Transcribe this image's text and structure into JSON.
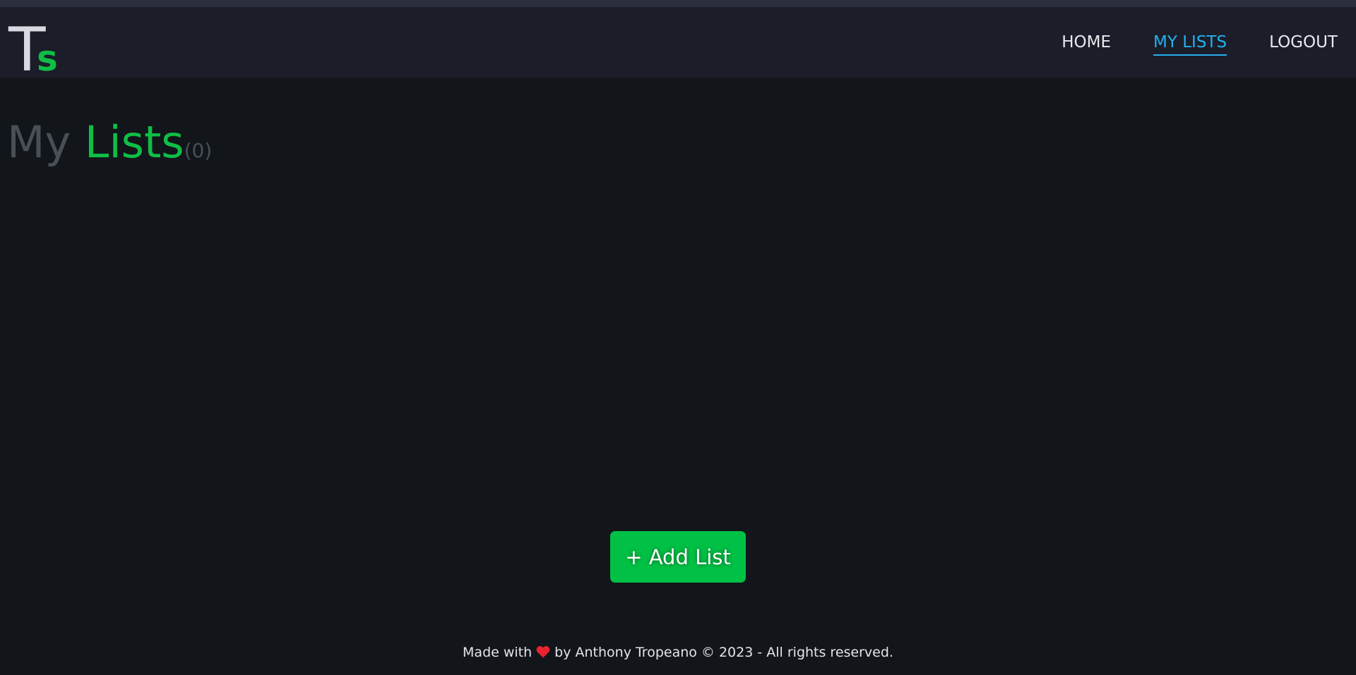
{
  "brand": {
    "logo_main": "T",
    "logo_sub": "s"
  },
  "nav": {
    "items": [
      {
        "label": "HOME",
        "active": false
      },
      {
        "label": "MY LISTS",
        "active": true
      },
      {
        "label": "LOGOUT",
        "active": false
      }
    ]
  },
  "page": {
    "title_part1": "My",
    "title_part2": "Lists",
    "count": "(0)"
  },
  "actions": {
    "add_list_label": "+ Add List"
  },
  "footer": {
    "prefix": "Made with",
    "heart_icon": "heart-icon",
    "suffix": "by Anthony Tropeano © 2023 - All rights reserved."
  },
  "colors": {
    "background": "#12151a",
    "navbar": "#1b1d29",
    "accent_green": "#0fbe45",
    "active_link": "#24b0ee",
    "muted": "#4a4e57",
    "heart": "#e8232f"
  }
}
